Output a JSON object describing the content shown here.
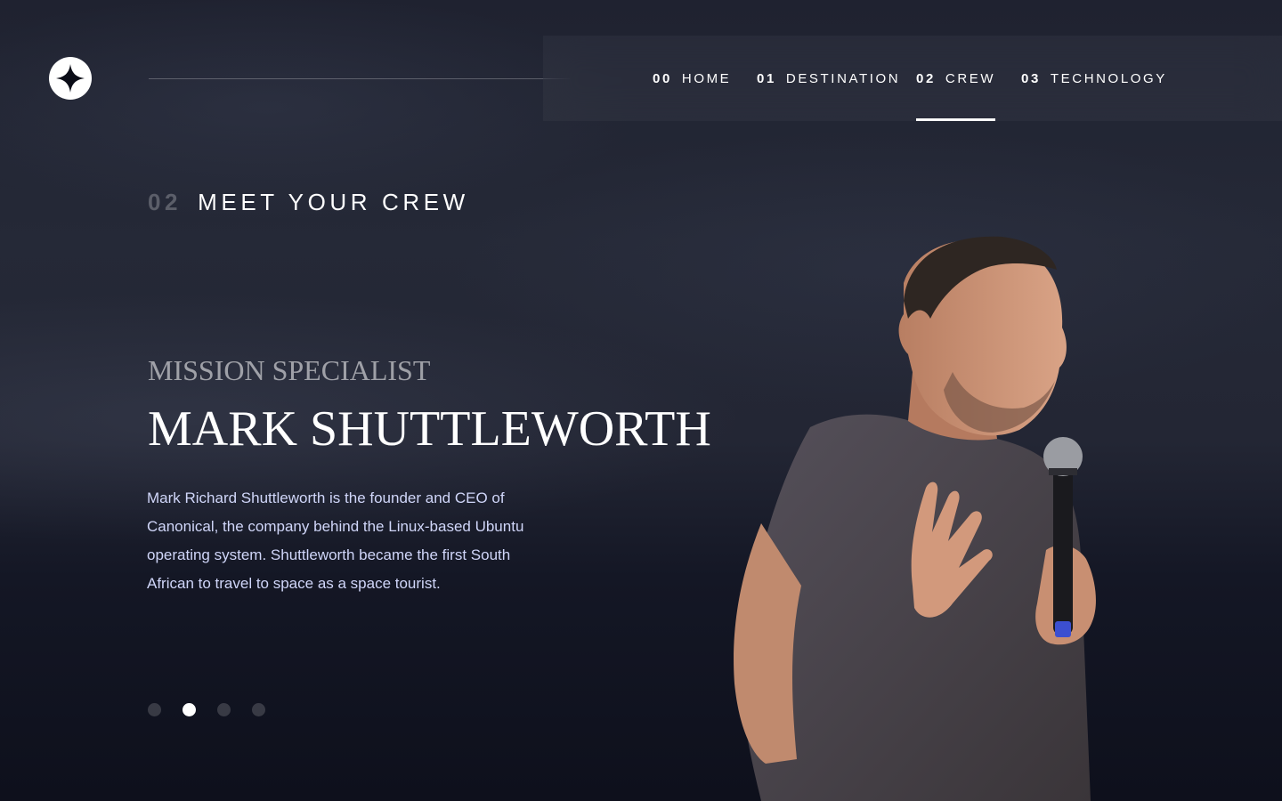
{
  "nav": {
    "items": [
      {
        "num": "00",
        "label": "HOME"
      },
      {
        "num": "01",
        "label": "DESTINATION"
      },
      {
        "num": "02",
        "label": "CREW"
      },
      {
        "num": "03",
        "label": "TECHNOLOGY"
      }
    ],
    "active_index": 2
  },
  "heading": {
    "num": "02",
    "text": "MEET YOUR CREW"
  },
  "crew": {
    "role": "Mission Specialist",
    "name": "Mark Shuttleworth",
    "bio": "Mark Richard Shuttleworth is the founder and CEO of Canonical, the company behind the Linux-based Ubuntu operating system. Shuttleworth became the first South African to travel to space as a space tourist."
  },
  "pagination": {
    "count": 4,
    "active_index": 1
  },
  "colors": {
    "background": "#0b0d17",
    "text": "#ffffff",
    "body_text": "#d0d6f9",
    "shirt": "#4a4549",
    "skin": "#c88f72"
  },
  "icons": {
    "logo": "star-logo-icon",
    "portrait": "crew-member-photo"
  }
}
